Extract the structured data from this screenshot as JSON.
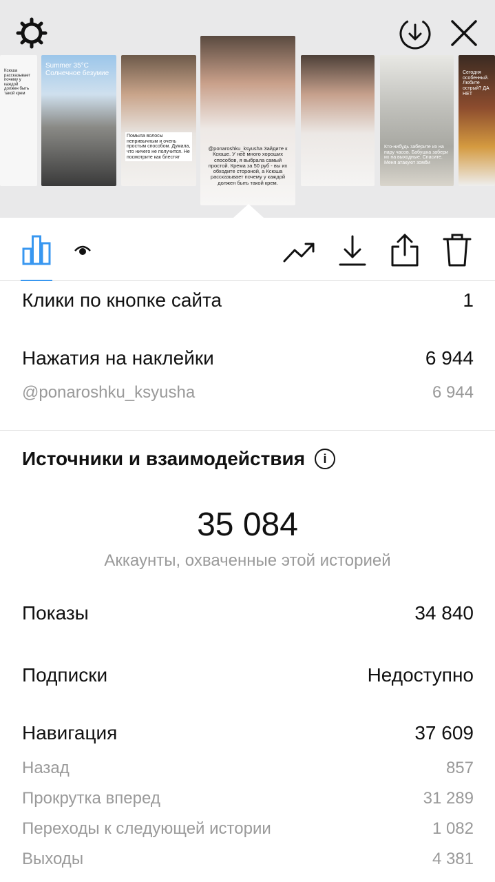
{
  "stories": [
    {
      "text": "Ксюша рассказывает почему у каждой должен быть такой крем"
    },
    {
      "text": "Summer 35°C Солнечное безумие"
    },
    {
      "text": "Помыла волосы непривычным и очень простым способом. Думала, что ничего не получится. Не посмотрите как блестят"
    },
    {
      "text": "@ponaroshku_ksyusha Зайдите к Ксюше. У неё много хороших способов, я выбрала самый простой. Крема за 50 руб - вы их обходите стороной, а Ксюша рассказывает почему у каждой должен быть такой крем."
    },
    {
      "text": ""
    },
    {
      "text": "Кто-нибудь заберите их на пару часов. Бабушка забери их на выходные. Спасите. Меня атакуют зомби"
    },
    {
      "text": "Сегодня особенный. Любите острый? ДА НЕТ"
    }
  ],
  "stats": {
    "website_clicks_label": "Клики по кнопке сайта",
    "website_clicks_value": "1",
    "sticker_taps_label": "Нажатия на наклейки",
    "sticker_taps_value": "6 944",
    "sticker_handle_label": "@ponaroshku_ksyusha",
    "sticker_handle_value": "6 944",
    "section_title": "Источники и взаимодействия",
    "info_glyph": "i",
    "reach_value": "35 084",
    "reach_label": "Аккаунты, охваченные этой историей",
    "impressions_label": "Показы",
    "impressions_value": "34 840",
    "follows_label": "Подписки",
    "follows_value": "Недоступно",
    "navigation_label": "Навигация",
    "navigation_value": "37 609",
    "back_label": "Назад",
    "back_value": "857",
    "forward_label": "Прокрутка вперед",
    "forward_value": "31 289",
    "next_story_label": "Переходы к следующей истории",
    "next_story_value": "1 082",
    "exits_label": "Выходы",
    "exits_value": "4 381"
  },
  "icons": {
    "settings": "gear-icon",
    "save": "download-circle-icon",
    "close": "close-icon",
    "insights": "bar-chart-icon",
    "viewers": "eye-icon",
    "promote": "trending-up-icon",
    "download": "download-icon",
    "share": "share-icon",
    "delete": "trash-icon"
  },
  "colors": {
    "accent": "#3897f0",
    "secondary_text": "#9a9a9a",
    "strip_background": "#e9e9ea"
  }
}
